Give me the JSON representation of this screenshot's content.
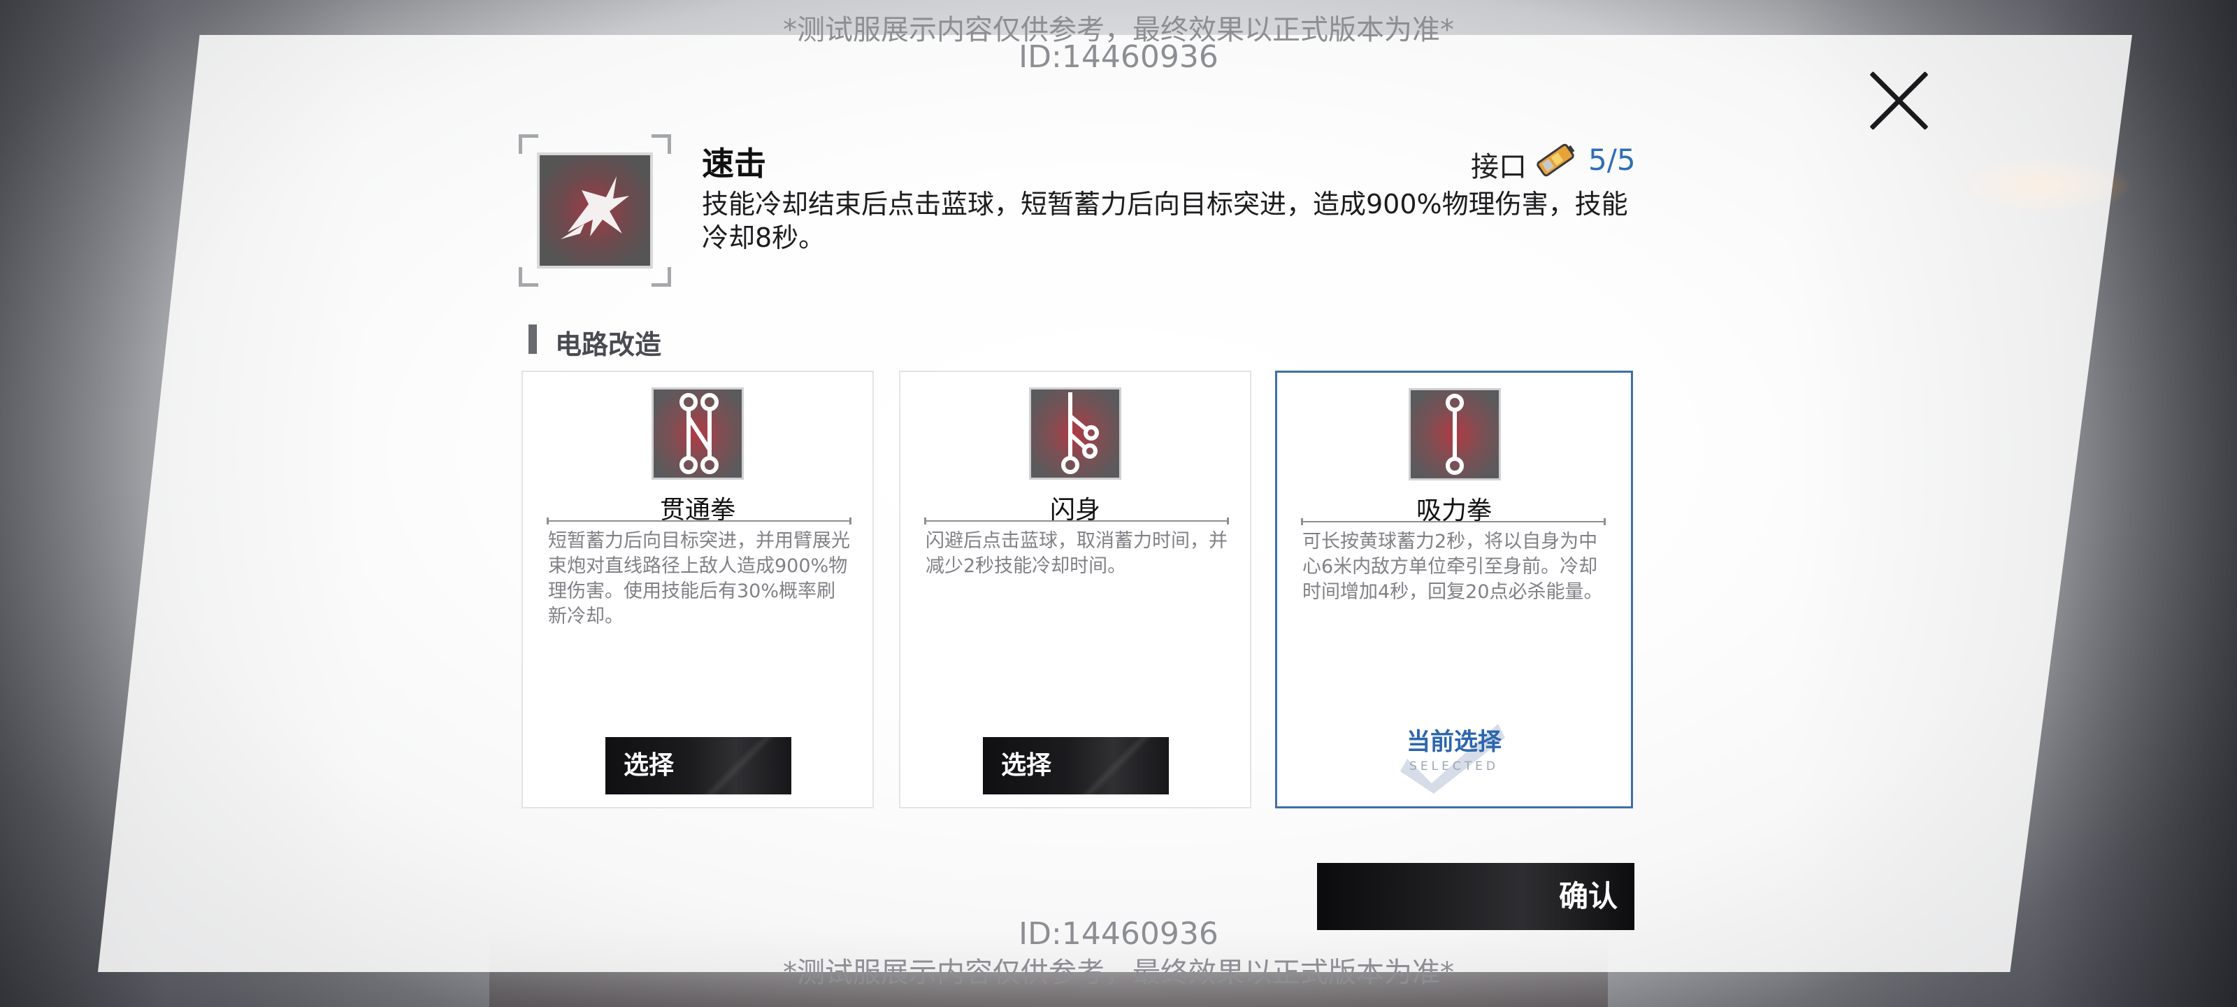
{
  "watermark": {
    "notice": "*测试服展示内容仅供参考，最终效果以正式版本为准*",
    "id": "ID:14460936"
  },
  "skill": {
    "name": "速击",
    "description": "技能冷却结束后点击蓝球，短暂蓄力后向目标突进，造成900%物理伤害，技能冷却8秒。",
    "interface_label": "接口",
    "interface_count": "5/5"
  },
  "section": {
    "title": "电路改造"
  },
  "cards": [
    {
      "name": "贯通拳",
      "icon": "circuit-double-node-icon",
      "description": "短暂蓄力后向目标突进，并用臂展光束炮对直线路径上敌人造成900%物理伤害。使用技能后有30%概率刷新冷却。",
      "button": "选择"
    },
    {
      "name": "闪身",
      "icon": "circuit-branch-icon",
      "description": "闪避后点击蓝球，取消蓄力时间，并减少2秒技能冷却时间。",
      "button": "选择"
    },
    {
      "name": "吸力拳",
      "icon": "circuit-straight-icon",
      "description": "可长按黄球蓄力2秒，将以自身为中心6米内敌方单位牵引至身前。冷却时间增加4秒，回复20点必杀能量。",
      "current_label": "当前选择",
      "selected_label": "SELECTED"
    }
  ],
  "confirm_label": "确认",
  "colors": {
    "accent_blue": "#2d66ad",
    "selected_border": "#3f6fa8",
    "icon_red": "#b03a44"
  }
}
